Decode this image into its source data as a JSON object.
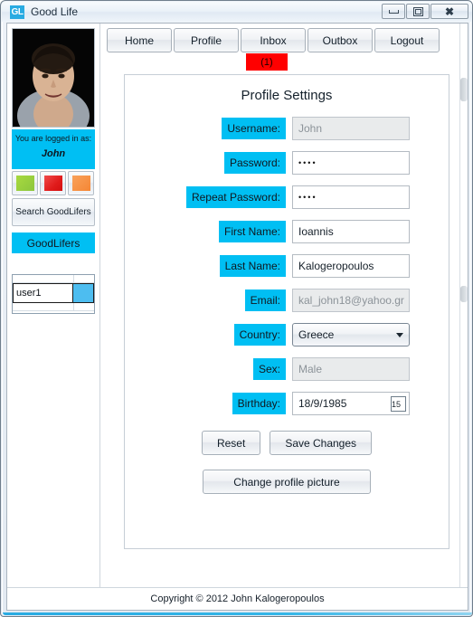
{
  "window": {
    "title": "Good Life",
    "logo_text": "GL",
    "controls": {
      "minimize": "minimize",
      "maximize": "maximize",
      "close": "close"
    }
  },
  "sidebar": {
    "avatar_alt": "profile-photo",
    "logged_in_label": "You are logged in as:",
    "logged_in_user": "John",
    "color_buttons": [
      {
        "name": "green",
        "color": "#8CC63E"
      },
      {
        "name": "red",
        "color": "#E01B1B"
      },
      {
        "name": "orange",
        "color": "#F58634"
      }
    ],
    "search_button": "Search GoodLifers",
    "goodlifers_header": "GoodLifers",
    "goodlifers_list": [
      {
        "name": "user1",
        "status_color": "#4DBDF0"
      }
    ]
  },
  "nav": {
    "tabs": [
      {
        "label": "Home"
      },
      {
        "label": "Profile"
      },
      {
        "label": "Inbox"
      },
      {
        "label": "Outbox"
      },
      {
        "label": "Logout"
      }
    ],
    "badge": "(1)",
    "badge_color": "#FF0000"
  },
  "panel": {
    "title": "Profile Settings",
    "fields": [
      {
        "label": "Username:",
        "value": "John",
        "type": "text",
        "disabled": true
      },
      {
        "label": "Password:",
        "value": "••••",
        "type": "password",
        "disabled": false
      },
      {
        "label": "Repeat Password:",
        "value": "••••",
        "type": "password",
        "disabled": false
      },
      {
        "label": "First Name:",
        "value": "Ioannis",
        "type": "text",
        "disabled": false
      },
      {
        "label": "Last Name:",
        "value": "Kalogeropoulos",
        "type": "text",
        "disabled": false
      },
      {
        "label": "Email:",
        "value": "kal_john18@yahoo.gr",
        "type": "text",
        "disabled": true
      },
      {
        "label": "Country:",
        "value": "Greece",
        "type": "select",
        "disabled": false
      },
      {
        "label": "Sex:",
        "value": "Male",
        "type": "text",
        "disabled": true
      },
      {
        "label": "Birthday:",
        "value": "18/9/1985",
        "type": "date",
        "disabled": false
      }
    ],
    "calendar_day": "15",
    "buttons": {
      "reset": "Reset",
      "save": "Save Changes",
      "change_picture": "Change profile picture"
    }
  },
  "footer": {
    "copyright": "Copyright © 2012 John Kalogeropoulos"
  },
  "theme": {
    "accent_cyan": "#00BFF3",
    "badge_red": "#FF0000"
  }
}
